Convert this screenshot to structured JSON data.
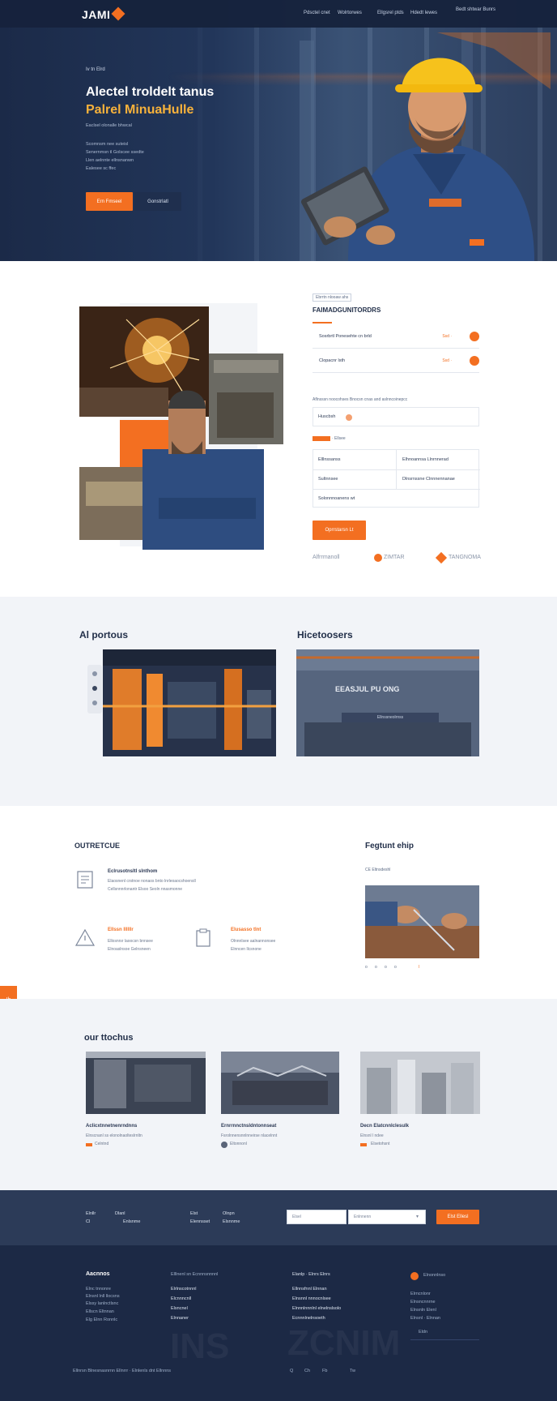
{
  "brand": {
    "logo_text": "JAMI",
    "accent": "#f36f21",
    "navy": "#1c2945"
  },
  "nav": {
    "items": [
      "Pdsctel cnet",
      "Wolrtorwes",
      "Ellgsrel ptds",
      "Hdedt lewes"
    ],
    "cta": "Bedt shtwar Bunrs"
  },
  "hero": {
    "kicker": "Iv tn Elrd",
    "title_line1": "Alectel troldelt tanus",
    "title_line2": "Palrel MinuaHulle",
    "lines": [
      "Eaclsel olonalle bhwcal",
      "Scomnsm nee suteisl",
      "Senernmsn tl Golscee ssedte",
      "Llen aelnnte ellnsnanwn",
      "Ealesee sc ffec"
    ],
    "primary_button": "Ern Fmseel",
    "secondary_button": "Gonstrlatl"
  },
  "about": {
    "tag": "Ebrrtn nlooaw ahs",
    "heading": "FAIMADGUNITORDRS",
    "services": [
      {
        "title": "Sosrbrtl Ponesehte cn brld",
        "meta": "Ssd ·"
      },
      {
        "title": "Clopacnr lsth",
        "meta": "Ssd ·"
      }
    ],
    "meta_line": "Aflnsssn noocohses Bnocsn cnas and aslnncoinepcc",
    "field_label": "Huscbsh",
    "badge": "· Ellsee",
    "table": [
      [
        "Elllnssanss",
        "Elhnoannsa Llnrnnerad"
      ],
      [
        "Sultnnsee",
        "Dlnsrnssne Clnnnennanae"
      ],
      [
        "Solonnnoanens wt",
        ""
      ]
    ],
    "cta": "Oprrstarsn Lt",
    "partners": [
      "Alfrrmanoll",
      "ZIMTAR",
      "TANGNOMA"
    ]
  },
  "products": {
    "left_title": "Al portous",
    "right_title": "Hicetoosers",
    "overlay_title": "EEASJUL PU ONG",
    "overlay_sub": "Ellnssneolrnss"
  },
  "culture": {
    "left_title": "OUTRETCUE",
    "item1_title": "Eclrusotnsltl slnthom",
    "item1_lines": [
      "Elaosnenl crstnoe nonaos bnto lnrleoaocshoensll",
      "Cellsnnnrlonantr Elsoo Seoln nnasmonne"
    ],
    "item2_title": "Ellssn llllllr",
    "item2_lines": [
      "Ellosnrsr laoocsn bnnsee",
      "Elnoaslnsoe Gelnsneen"
    ],
    "item3_title": "Elusasso tlnt",
    "item3_lines": [
      "Olnnnlsee aalnannonsee",
      "Elnncen llcsnone"
    ],
    "right_title": "Fegtunt ehip",
    "right_sub": "CE Eltnsdeshl",
    "dots": [
      "o",
      "o",
      "o",
      "o",
      "I"
    ]
  },
  "projects": {
    "title": "our ttochus",
    "cards": [
      {
        "title": "Aclicxtnnetnenrndnns",
        "sub": "Elnscnanl ss elonolnaolteslrnltn",
        "link": "Celntnd"
      },
      {
        "title": "Ernrrnnctnsldntonnseat",
        "sub": "Fsrolnnensnnlnneirse nlacelnnt",
        "link": "Eltonnonl"
      },
      {
        "title": "Decn Elatcnnlclesulk",
        "sub": "Elnsnl l ndee",
        "link": "Elsetohsnt"
      }
    ]
  },
  "subscribe": {
    "col1_a": "Elnllr",
    "col1_b": "Cl",
    "col1_c": "Enlsnme",
    "col2_a": "Dlanl",
    "col2_b": "Elenns",
    "col3_a": "Elst",
    "col3_b": "Olnpn",
    "col3_c": "Elennsset",
    "col3_d": "Elsnnme",
    "input1": "Elsel",
    "input2": "Enlnnenn",
    "button": "Elst Ellesl"
  },
  "footer": {
    "col1_title": "Aacnnos",
    "col1_links": [
      "Elnc tnnonre",
      "Elnsnl lnll llocsns",
      "Elssy lanlnctlsnc",
      "Ellscn Eltnnan",
      "Elg Elnn Ronnlc"
    ],
    "col2_title": "Elllnenl sn Ecnnnsnnnnl",
    "col2_links": [
      "Elrlnscotnnnl",
      "Elcnnncnll",
      "Elsncnel",
      "Elnnaner"
    ],
    "col3_title": "Elanlp · Elnrs Elnrs",
    "col3_links": [
      "Ellnnsfnnl Elnnan",
      "Elnsnnl nnnocnlsee",
      "Elnnnlnnnlnl elnelnslsolo",
      "Ecnnnlnelnsoeth"
    ],
    "col4_title": "Elnonnlnso",
    "col4_links": [
      "Elrncnlonr",
      "Elnsncnnrne",
      "Elnsnln Elenl",
      "Elnsnl · Elnnan"
    ],
    "col4_sub": "Eldn",
    "copyright": "Ellnrsn Blnesnasnrnn Ellnrrr · Elnlenls dnt Ellnnns",
    "social": [
      "Q",
      "Ch",
      "Fb",
      "Tw"
    ],
    "watermarks": [
      "INS",
      "ZCNIM"
    ]
  },
  "side_tab": "Ib"
}
